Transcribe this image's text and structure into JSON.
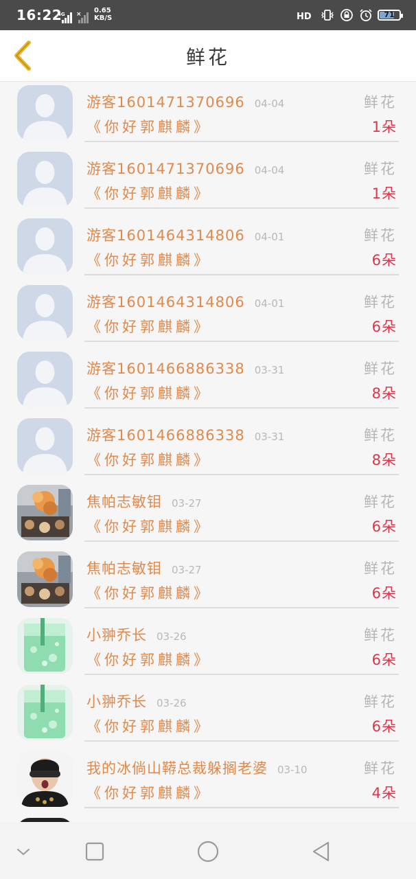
{
  "status_bar": {
    "time": "16:22",
    "net_speed_value": "0.65",
    "net_speed_unit": "KB/S",
    "network_type": "4G",
    "battery_level": "71"
  },
  "header": {
    "title": "鲜花"
  },
  "records": [
    {
      "name": "游客1601471370696",
      "date": "04-04",
      "type": "鲜花",
      "message": "《你好郭麒麟》",
      "count": "1朵",
      "avatar": "default"
    },
    {
      "name": "游客1601471370696",
      "date": "04-04",
      "type": "鲜花",
      "message": "《你好郭麒麟》",
      "count": "1朵",
      "avatar": "default"
    },
    {
      "name": "游客1601464314806",
      "date": "04-01",
      "type": "鲜花",
      "message": "《你好郭麒麟》",
      "count": "6朵",
      "avatar": "default"
    },
    {
      "name": "游客1601464314806",
      "date": "04-01",
      "type": "鲜花",
      "message": "《你好郭麒麟》",
      "count": "6朵",
      "avatar": "default"
    },
    {
      "name": "游客1601466886338",
      "date": "03-31",
      "type": "鲜花",
      "message": "《你好郭麒麟》",
      "count": "8朵",
      "avatar": "default"
    },
    {
      "name": "游客1601466886338",
      "date": "03-31",
      "type": "鲜花",
      "message": "《你好郭麒麟》",
      "count": "8朵",
      "avatar": "default"
    },
    {
      "name": "焦帕志敏钼",
      "date": "03-27",
      "type": "鲜花",
      "message": "《你好郭麒麟》",
      "count": "6朵",
      "avatar": "photo-orange"
    },
    {
      "name": "焦帕志敏钼",
      "date": "03-27",
      "type": "鲜花",
      "message": "《你好郭麒麟》",
      "count": "6朵",
      "avatar": "photo-orange"
    },
    {
      "name": "小翀乔长",
      "date": "03-26",
      "type": "鲜花",
      "message": "《你好郭麒麟》",
      "count": "6朵",
      "avatar": "photo-green"
    },
    {
      "name": "小翀乔长",
      "date": "03-26",
      "type": "鲜花",
      "message": "《你好郭麒麟》",
      "count": "6朵",
      "avatar": "photo-green"
    },
    {
      "name": "我的冰倘山鞯总裁躲搁老婆",
      "date": "03-10",
      "type": "鲜花",
      "message": "《你好郭麒麟》",
      "count": "4朵",
      "avatar": "photo-person"
    }
  ],
  "colors": {
    "accent": "#e0894b",
    "count": "#e0344a",
    "back_arrow": "#e8b52a"
  }
}
